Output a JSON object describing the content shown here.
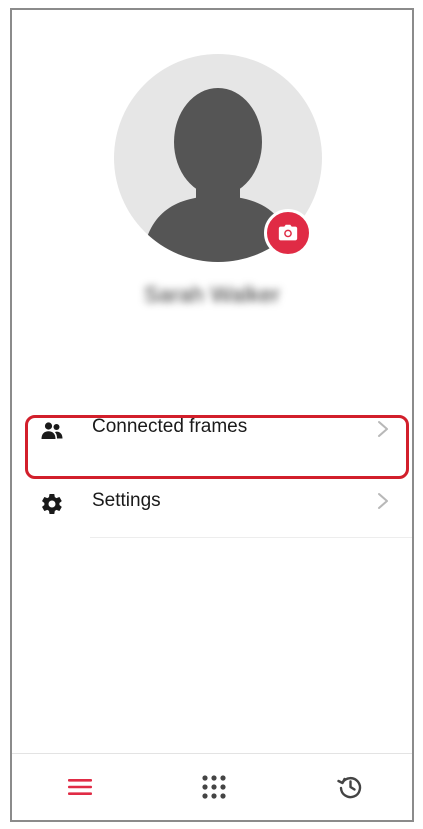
{
  "profile": {
    "name": "Sarah Walker",
    "avatar_icon": "person-silhouette-icon",
    "camera_icon": "camera-icon"
  },
  "menu": {
    "items": [
      {
        "label": "Connected frames",
        "icon": "people-icon",
        "chevron": "chevron-right-icon",
        "highlighted": true
      },
      {
        "label": "Settings",
        "icon": "gear-icon",
        "chevron": "chevron-right-icon",
        "highlighted": false
      }
    ]
  },
  "tab_bar": {
    "tabs": [
      {
        "icon": "hamburger-menu-icon",
        "active": true
      },
      {
        "icon": "grid-icon",
        "active": false
      },
      {
        "icon": "history-icon",
        "active": false
      }
    ]
  },
  "colors": {
    "accent": "#e02b45",
    "highlight_border": "#d21f2b",
    "avatar_background": "#e6e6e6",
    "avatar_figure": "#555555",
    "text_primary": "#1a1a1a",
    "chevron": "#b8b8b8",
    "tab_icon": "#444444"
  }
}
